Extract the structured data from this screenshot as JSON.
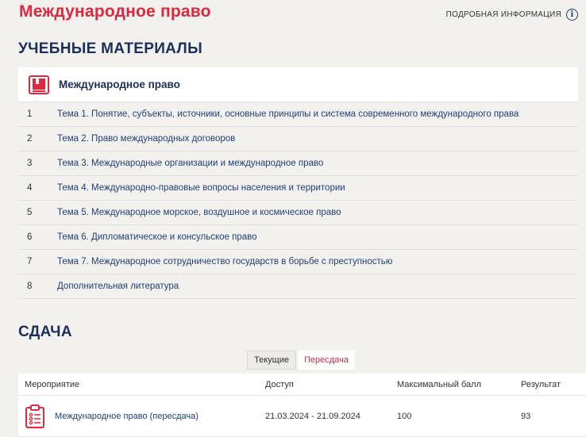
{
  "page": {
    "title": "Международное право",
    "info_link": "ПОДРОБНАЯ ИНФОРМАЦИЯ",
    "info_icon_glyph": "i"
  },
  "materials": {
    "section_title": "УЧЕБНЫЕ МАТЕРИАЛЫ",
    "course_name": "Международное право",
    "topics": [
      {
        "num": "1",
        "label": "Тема 1. Понятие, субъекты, источники, основные принципы и система современного международного права"
      },
      {
        "num": "2",
        "label": "Тема 2. Право международных договоров"
      },
      {
        "num": "3",
        "label": "Тема 3. Международные организации и международное право"
      },
      {
        "num": "4",
        "label": "Тема 4. Международно-правовые вопросы населения и территории"
      },
      {
        "num": "5",
        "label": "Тема 5. Международное морское, воздушное и космическое право"
      },
      {
        "num": "6",
        "label": "Тема 6. Дипломатическое и консульское право"
      },
      {
        "num": "7",
        "label": "Тема 7. Международное сотрудничество государств в борьбе с преступностью"
      },
      {
        "num": "8",
        "label": "Дополнительная литература"
      }
    ]
  },
  "exam": {
    "section_title": "СДАЧА",
    "tabs": [
      {
        "label": "Текущие",
        "active": false
      },
      {
        "label": "Пересдача",
        "active": true
      }
    ],
    "columns": [
      "Мероприятие",
      "Доступ",
      "Максимальный балл",
      "Результат"
    ],
    "rows": [
      {
        "event": "Международное право (пересдача)",
        "access": "21.03.2024 - 21.09.2024",
        "max_score": "100",
        "result": "93"
      }
    ]
  },
  "colors": {
    "accent_red": "#e0273e",
    "navy": "#1b2f5c",
    "link_blue": "#1f3f7a",
    "background": "#f2f1ee"
  },
  "icons": {
    "book": "book-icon",
    "info": "info-icon",
    "clipboard": "clipboard-list-icon"
  }
}
